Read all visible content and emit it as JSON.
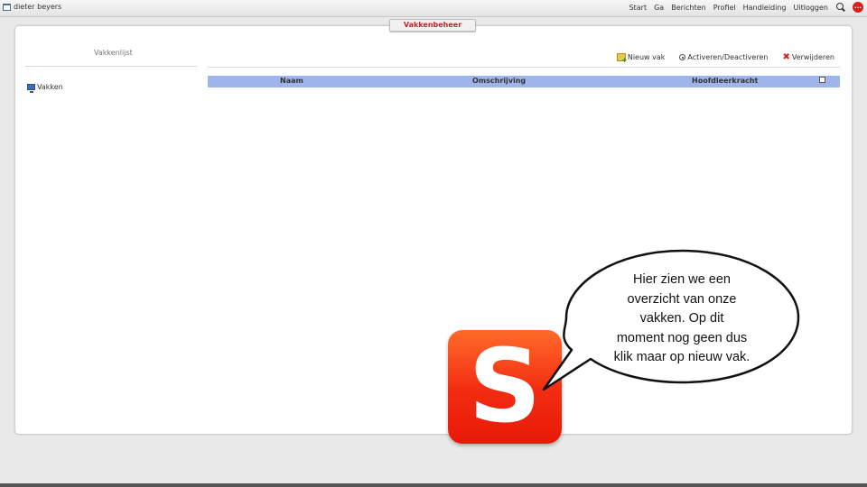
{
  "topbar": {
    "user_name": "dieter beyers",
    "nav": [
      "Start",
      "Ga",
      "Berichten",
      "Profiel",
      "Handleiding",
      "Uitloggen"
    ],
    "chat_badge": "..."
  },
  "panel": {
    "tab_title": "Vakkenbeheer"
  },
  "sidebar": {
    "title": "Vakkenlijst",
    "items": [
      {
        "label": "Vakken",
        "icon": "monitor-icon"
      }
    ]
  },
  "toolbar": {
    "new_label": "Nieuw vak",
    "activate_label": "Activeren/Deactiveren",
    "delete_label": "Verwijderen"
  },
  "table": {
    "columns": [
      "Naam",
      "Omschrijving",
      "Hoofdleerkracht"
    ],
    "rows": []
  },
  "logo": {
    "letter": "S"
  },
  "bubble": {
    "lines": [
      "Hier zien we een",
      "overzicht van onze",
      "vakken. Op dit",
      "moment nog geen dus",
      "klik maar op nieuw vak."
    ]
  },
  "colors": {
    "table_header": "#9fb4ea",
    "tab_title": "#c0282a",
    "logo": "#f22b10"
  }
}
